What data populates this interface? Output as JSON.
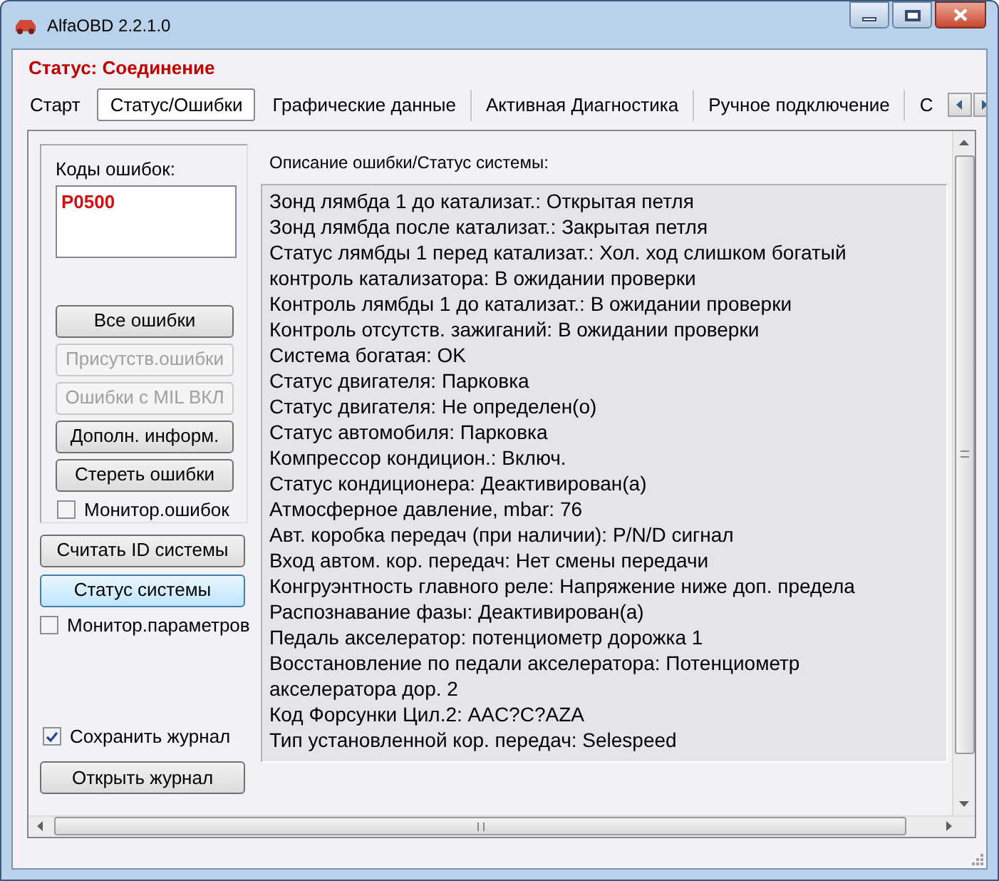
{
  "window": {
    "title": "AlfaOBD 2.2.1.0"
  },
  "status": "Статус: Соединение",
  "tabs": [
    {
      "label": "Старт",
      "selected": false
    },
    {
      "label": "Статус/Ошибки",
      "selected": true
    },
    {
      "label": "Графические данные",
      "selected": false
    },
    {
      "label": "Активная Диагностика",
      "selected": false
    },
    {
      "label": "Ручное подключение",
      "selected": false
    },
    {
      "label": "С",
      "selected": false
    }
  ],
  "error_codes": {
    "label": "Коды ошибок:",
    "items": [
      "P0500"
    ]
  },
  "error_buttons": [
    {
      "label": "Все ошибки",
      "disabled": false
    },
    {
      "label": "Присутств.ошибки",
      "disabled": true
    },
    {
      "label": "Ошибки с MIL ВКЛ",
      "disabled": true
    },
    {
      "label": "Дополн. информ.",
      "disabled": false
    },
    {
      "label": "Стереть ошибки",
      "disabled": false
    }
  ],
  "monitor_errors": {
    "label": "Монитор.ошибок",
    "checked": false
  },
  "system_buttons": [
    {
      "label": "Считать ID системы",
      "focused": false
    },
    {
      "label": "Статус системы",
      "focused": true
    }
  ],
  "monitor_params": {
    "label": "Монитор.параметров",
    "checked": false
  },
  "save_log": {
    "label": "Сохранить журнал",
    "checked": true
  },
  "open_log_button": "Открыть журнал",
  "description": {
    "label": "Описание ошибки/Статус системы:",
    "lines": [
      "Зонд лямбда 1 до катализат.: Открытая петля",
      "Зонд лямбда после катализат.: Закрытая петля",
      "Статус лямбды 1 перед катализат.: Хол. ход слишком богатый",
      "контроль катализатора: В ожидании проверки",
      "Контроль лямбды 1 до катализат.: В ожидании проверки",
      "Контроль отсутств. зажиганий: В ожидании проверки",
      "Система богатая: OK",
      "Статус двигателя: Парковка",
      "Статус двигателя: Не определен(о)",
      "Статус автомобиля: Парковка",
      "Компрессор кондицион.: Включ.",
      "Статус кондиционера: Деактивирован(а)",
      "Атмосферное давление, mbar: 76",
      "Авт. коробка передач (при наличии): P/N/D сигнал",
      "Вход автом. кор. передач: Нет смены передачи",
      "Конгруэнтность главного реле: Напряжение ниже доп. предела",
      "Распознавание фазы: Деактивирован(а)",
      "Педаль акселератор: потенциометр дорожка 1",
      "Восстановление по педали акселератора: Потенциометр акселератора дор. 2",
      "Код Форсунки Цил.2: AAC?C?AZA",
      "Тип установленной кор. передач: Selespeed"
    ]
  }
}
